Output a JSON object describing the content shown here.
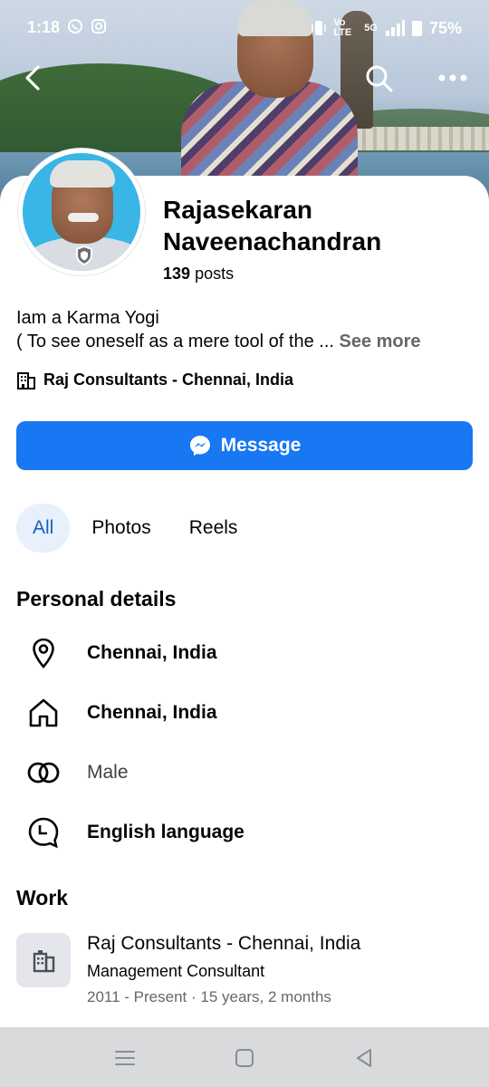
{
  "status_bar": {
    "time": "1:18",
    "network": "Vo LTE",
    "signal": "5G",
    "battery": "75%"
  },
  "profile": {
    "name_line1": "Rajasekaran",
    "name_line2": "Naveenachandran",
    "posts_count": "139",
    "posts_label": "posts",
    "bio_line1": "Iam a Karma Yogi",
    "bio_line2": "( To see oneself as a mere tool of the ...",
    "see_more": "See more",
    "workplace": "Raj Consultants - Chennai, India"
  },
  "actions": {
    "message_label": "Message"
  },
  "tabs": [
    {
      "label": "All",
      "active": true
    },
    {
      "label": "Photos",
      "active": false
    },
    {
      "label": "Reels",
      "active": false
    }
  ],
  "personal_details": {
    "title": "Personal details",
    "items": [
      {
        "icon": "location-pin-icon",
        "text": "Chennai, India"
      },
      {
        "icon": "home-icon",
        "text": "Chennai, India"
      },
      {
        "icon": "gender-rings-icon",
        "text": "Male"
      },
      {
        "icon": "language-chat-icon",
        "text": "English language"
      }
    ]
  },
  "work": {
    "title": "Work",
    "company": "Raj Consultants - Chennai, India",
    "position": "Management Consultant",
    "duration": "2011 - Present · 15 years, 2 months"
  },
  "colors": {
    "accent": "#1877f2",
    "tab_active_bg": "#e7f0fb",
    "tab_active_text": "#1360c6"
  }
}
